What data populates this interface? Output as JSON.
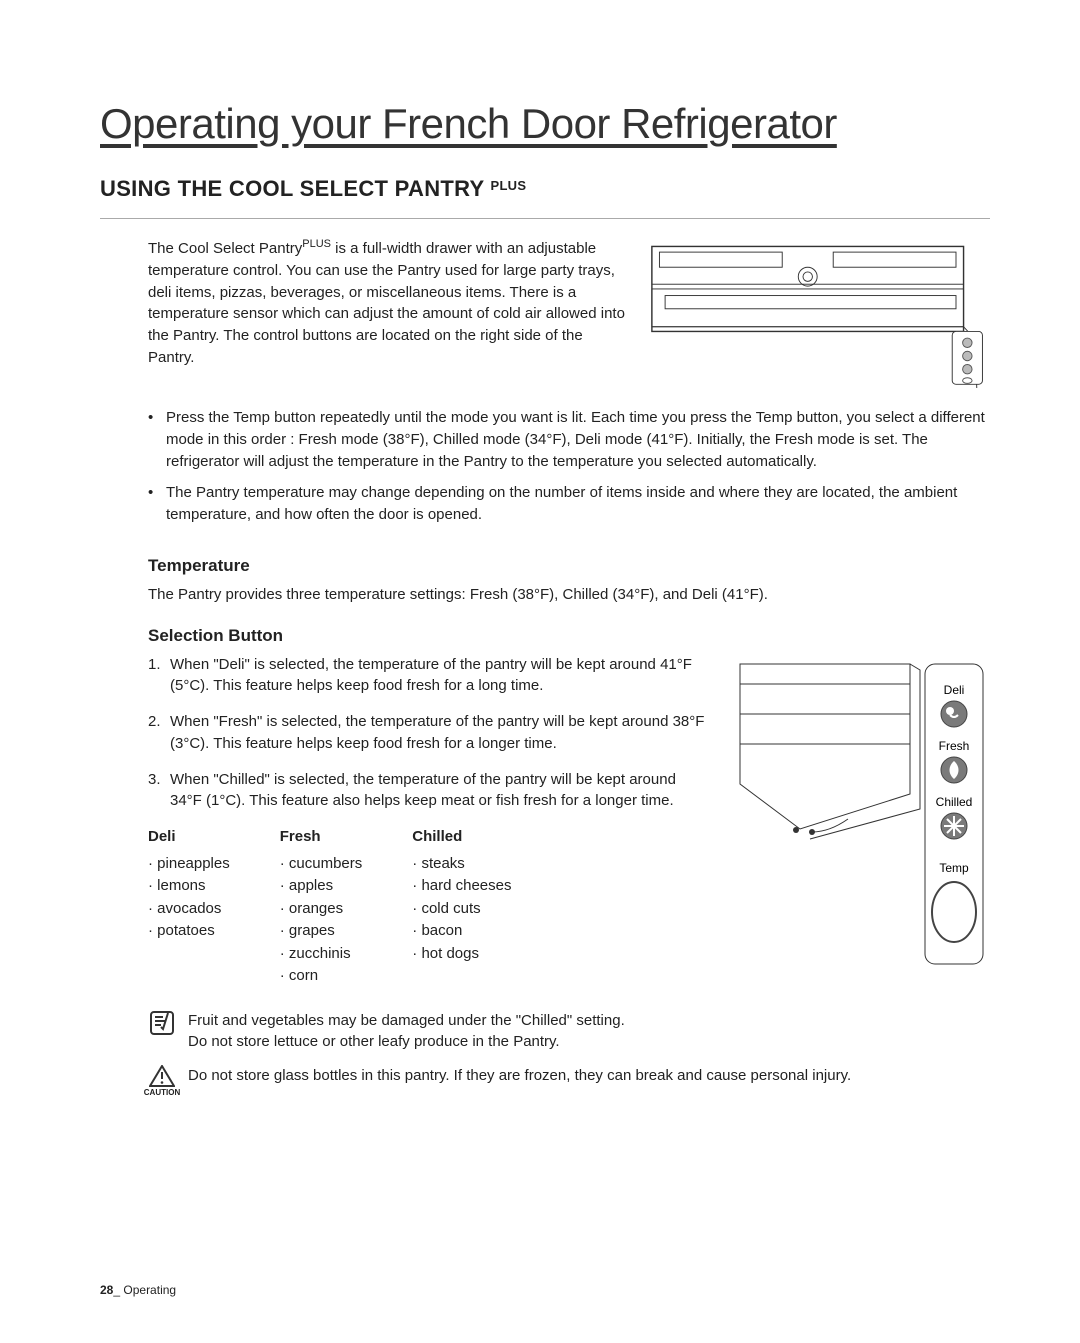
{
  "page_title": "Operating your French Door Refrigerator",
  "section": {
    "heading": "USING THE COOL SELECT PANTRY",
    "heading_sup": "PLUS"
  },
  "intro": {
    "prefix": "The Cool Select Pantry",
    "sup": "PLUS",
    "rest": " is a full-width drawer with an adjustable temperature control. You can use the Pantry used for large party trays, deli items, pizzas, beverages, or miscellaneous items. There is a temperature sensor which can adjust the amount of cold air allowed into the Pantry. The control buttons are located on the right side of the Pantry."
  },
  "bullets": [
    "Press the Temp button repeatedly until the mode you want is lit. Each time you press the Temp button, you select a different mode in this order : Fresh mode (38°F), Chilled mode (34°F), Deli mode (41°F). Initially, the Fresh mode is set. The refrigerator will adjust the temperature in the Pantry to the temperature you selected automatically.",
    "The Pantry temperature may change depending on the number of items inside and where they are located, the ambient temperature, and how often the door is opened."
  ],
  "temperature": {
    "heading": "Temperature",
    "body": "The Pantry provides three temperature settings: Fresh (38°F), Chilled (34°F), and Deli (41°F)."
  },
  "selection": {
    "heading": "Selection Button",
    "steps": [
      "When \"Deli\" is selected, the temperature of the pantry will be kept around 41°F (5°C). This feature helps keep food fresh for a long time.",
      "When \"Fresh\" is selected, the temperature of the pantry will be kept around 38°F (3°C). This feature helps keep food fresh for a longer time.",
      "When \"Chilled\" is selected, the temperature of the pantry will be kept around 34°F (1°C). This feature also helps keep meat or fish fresh for a longer time."
    ]
  },
  "panel_labels": {
    "deli": "Deli",
    "fresh": "Fresh",
    "chilled": "Chilled",
    "temp": "Temp"
  },
  "foods": {
    "deli": {
      "head": "Deli",
      "items": [
        "pineapples",
        "lemons",
        "avocados",
        "potatoes"
      ]
    },
    "fresh": {
      "head": "Fresh",
      "items": [
        "cucumbers",
        "apples",
        "oranges",
        "grapes",
        "zucchinis",
        "corn"
      ]
    },
    "chilled": {
      "head": "Chilled",
      "items": [
        "steaks",
        "hard cheeses",
        "cold cuts",
        "bacon",
        "hot dogs"
      ]
    }
  },
  "note": {
    "line1": "Fruit and vegetables may be damaged under the \"Chilled\" setting.",
    "line2": "Do not store lettuce or other leafy produce in the Pantry."
  },
  "caution": {
    "label": "CAUTION",
    "body": "Do not store glass bottles in this pantry. If they are frozen, they can break and cause personal injury."
  },
  "footer": {
    "page_num": "28",
    "sep": "_",
    "section": " Operating"
  }
}
